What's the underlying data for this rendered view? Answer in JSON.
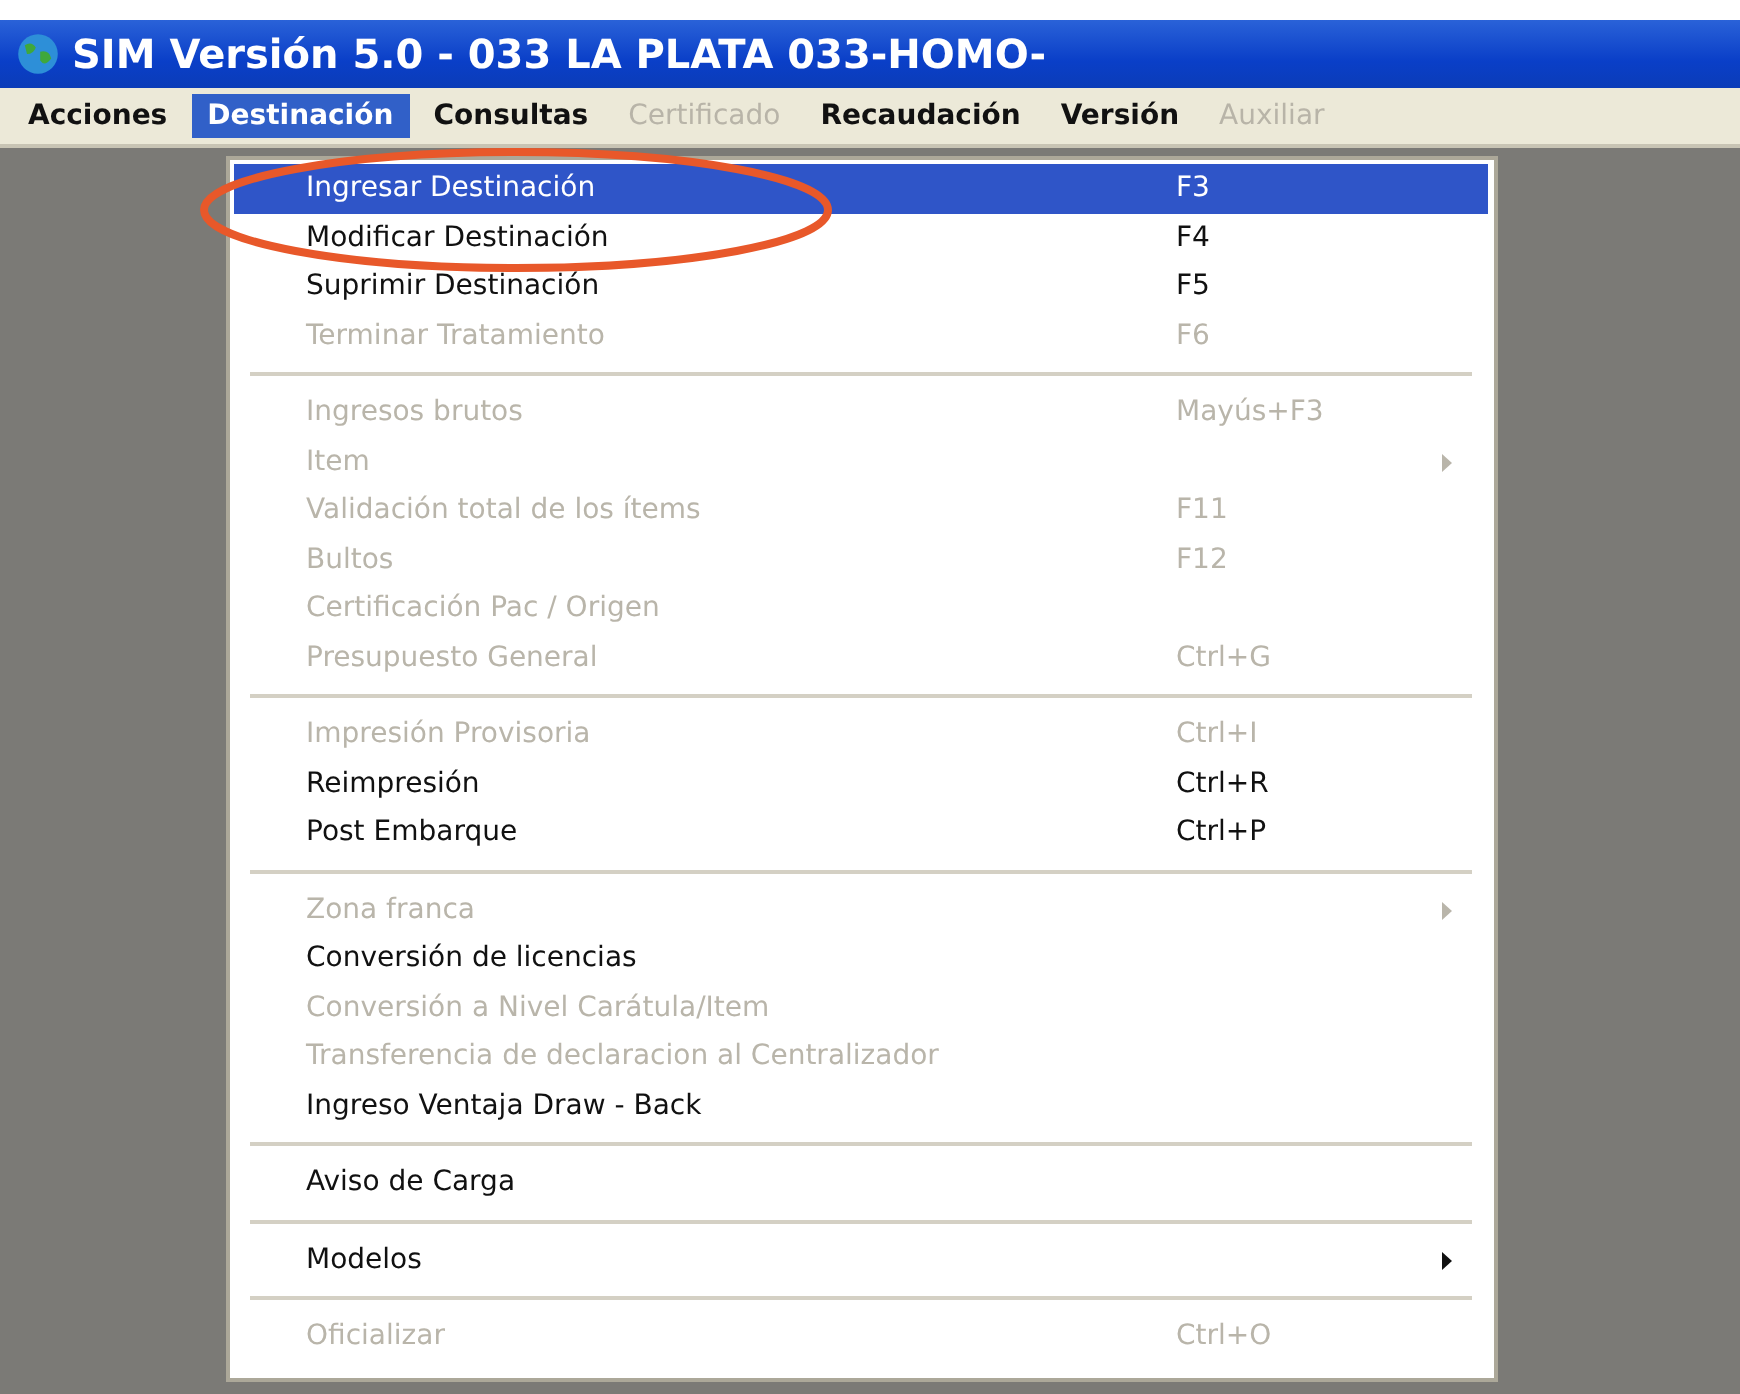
{
  "window": {
    "title": "SIM Versión 5.0 - 033 LA PLATA 033-HOMO-"
  },
  "menu_bar": [
    {
      "label": "Acciones",
      "selected": false,
      "disabled": false
    },
    {
      "label": "Destinación",
      "selected": true,
      "disabled": false
    },
    {
      "label": "Consultas",
      "selected": false,
      "disabled": false
    },
    {
      "label": "Certificado",
      "selected": false,
      "disabled": true
    },
    {
      "label": "Recaudación",
      "selected": false,
      "disabled": false
    },
    {
      "label": "Versión",
      "selected": false,
      "disabled": false
    },
    {
      "label": "Auxiliar",
      "selected": false,
      "disabled": true
    }
  ],
  "menu": {
    "groups": [
      {
        "items": [
          {
            "label": "Ingresar Destinación",
            "shortcut": "F3",
            "selected": true,
            "disabled": false,
            "submenu": false
          },
          {
            "label": "Modificar Destinación",
            "shortcut": "F4",
            "selected": false,
            "disabled": false,
            "submenu": false
          },
          {
            "label": "Suprimir Destinación",
            "shortcut": "F5",
            "selected": false,
            "disabled": false,
            "submenu": false
          },
          {
            "label": "Terminar Tratamiento",
            "shortcut": "F6",
            "selected": false,
            "disabled": true,
            "submenu": false
          }
        ]
      },
      {
        "items": [
          {
            "label": "Ingresos brutos",
            "shortcut": "Mayús+F3",
            "selected": false,
            "disabled": true,
            "submenu": false
          },
          {
            "label": "Item",
            "selected": false,
            "disabled": true,
            "submenu": true
          },
          {
            "label": "Validación total de los ítems",
            "shortcut": "F11",
            "selected": false,
            "disabled": true,
            "submenu": false
          },
          {
            "label": "Bultos",
            "shortcut": "F12",
            "selected": false,
            "disabled": true,
            "submenu": false
          },
          {
            "label": "Certificación Pac / Origen",
            "selected": false,
            "disabled": true,
            "submenu": false
          },
          {
            "label": "Presupuesto General",
            "shortcut": "Ctrl+G",
            "selected": false,
            "disabled": true,
            "submenu": false
          }
        ]
      },
      {
        "items": [
          {
            "label": "Impresión Provisoria",
            "shortcut": "Ctrl+I",
            "selected": false,
            "disabled": true,
            "submenu": false
          },
          {
            "label": "Reimpresión",
            "shortcut": "Ctrl+R",
            "selected": false,
            "disabled": false,
            "submenu": false
          },
          {
            "label": "Post Embarque",
            "shortcut": "Ctrl+P",
            "selected": false,
            "disabled": false,
            "submenu": false
          }
        ]
      },
      {
        "items": [
          {
            "label": "Zona franca",
            "selected": false,
            "disabled": true,
            "submenu": true
          },
          {
            "label": "Conversión de licencias",
            "selected": false,
            "disabled": false,
            "submenu": false
          },
          {
            "label": "Conversión a Nivel Carátula/Item",
            "selected": false,
            "disabled": true,
            "submenu": false
          },
          {
            "label": "Transferencia de declaracion al Centralizador",
            "selected": false,
            "disabled": true,
            "submenu": false
          },
          {
            "label": "Ingreso Ventaja Draw - Back",
            "selected": false,
            "disabled": false,
            "submenu": false
          }
        ]
      },
      {
        "items": [
          {
            "label": "Aviso de Carga",
            "selected": false,
            "disabled": false,
            "submenu": false
          }
        ]
      },
      {
        "items": [
          {
            "label": "Modelos",
            "selected": false,
            "disabled": false,
            "submenu": true
          }
        ]
      },
      {
        "items": [
          {
            "label": "Oficializar",
            "shortcut": "Ctrl+O",
            "selected": false,
            "disabled": true,
            "submenu": false
          }
        ]
      }
    ]
  }
}
